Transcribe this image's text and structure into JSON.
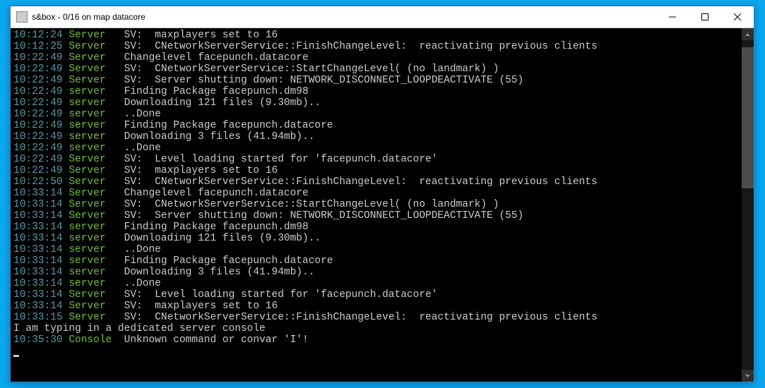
{
  "window": {
    "title": "s&box  -  0/16 on map datacore"
  },
  "console": {
    "lines": [
      {
        "ts": "10:12:24",
        "src": "Server",
        "msg": "SV:  maxplayers set to 16"
      },
      {
        "ts": "10:12:25",
        "src": "Server",
        "msg": "SV:  CNetworkServerService::FinishChangeLevel:  reactivating previous clients"
      },
      {
        "ts": "10:22:49",
        "src": "Server",
        "msg": "Changelevel facepunch.datacore"
      },
      {
        "ts": "10:22:49",
        "src": "Server",
        "msg": "SV:  CNetworkServerService::StartChangeLevel( (no landmark) )"
      },
      {
        "ts": "10:22:49",
        "src": "Server",
        "msg": "SV:  Server shutting down: NETWORK_DISCONNECT_LOOPDEACTIVATE (55)"
      },
      {
        "ts": "10:22:49",
        "src": "server",
        "msg": "Finding Package facepunch.dm98"
      },
      {
        "ts": "10:22:49",
        "src": "server",
        "msg": "Downloading 121 files (9.30mb).."
      },
      {
        "ts": "10:22:49",
        "src": "server",
        "msg": "..Done"
      },
      {
        "ts": "10:22:49",
        "src": "server",
        "msg": "Finding Package facepunch.datacore"
      },
      {
        "ts": "10:22:49",
        "src": "server",
        "msg": "Downloading 3 files (41.94mb).."
      },
      {
        "ts": "10:22:49",
        "src": "server",
        "msg": "..Done"
      },
      {
        "ts": "10:22:49",
        "src": "Server",
        "msg": "SV:  Level loading started for 'facepunch.datacore'"
      },
      {
        "ts": "10:22:49",
        "src": "Server",
        "msg": "SV:  maxplayers set to 16"
      },
      {
        "ts": "10:22:50",
        "src": "Server",
        "msg": "SV:  CNetworkServerService::FinishChangeLevel:  reactivating previous clients"
      },
      {
        "ts": "10:33:14",
        "src": "Server",
        "msg": "Changelevel facepunch.datacore"
      },
      {
        "ts": "10:33:14",
        "src": "Server",
        "msg": "SV:  CNetworkServerService::StartChangeLevel( (no landmark) )"
      },
      {
        "ts": "10:33:14",
        "src": "Server",
        "msg": "SV:  Server shutting down: NETWORK_DISCONNECT_LOOPDEACTIVATE (55)"
      },
      {
        "ts": "10:33:14",
        "src": "server",
        "msg": "Finding Package facepunch.dm98"
      },
      {
        "ts": "10:33:14",
        "src": "server",
        "msg": "Downloading 121 files (9.30mb).."
      },
      {
        "ts": "10:33:14",
        "src": "server",
        "msg": "..Done"
      },
      {
        "ts": "10:33:14",
        "src": "server",
        "msg": "Finding Package facepunch.datacore"
      },
      {
        "ts": "10:33:14",
        "src": "server",
        "msg": "Downloading 3 files (41.94mb).."
      },
      {
        "ts": "10:33:14",
        "src": "server",
        "msg": "..Done"
      },
      {
        "ts": "10:33:14",
        "src": "Server",
        "msg": "SV:  Level loading started for 'facepunch.datacore'"
      },
      {
        "ts": "10:33:14",
        "src": "Server",
        "msg": "SV:  maxplayers set to 16"
      },
      {
        "ts": "10:33:15",
        "src": "Server",
        "msg": "SV:  CNetworkServerService::FinishChangeLevel:  reactivating previous clients"
      },
      {
        "raw": "I am typing in a dedicated server console"
      },
      {
        "ts": "10:35:30",
        "src": "Console",
        "msg": "Unknown command or convar 'I'!"
      }
    ]
  }
}
